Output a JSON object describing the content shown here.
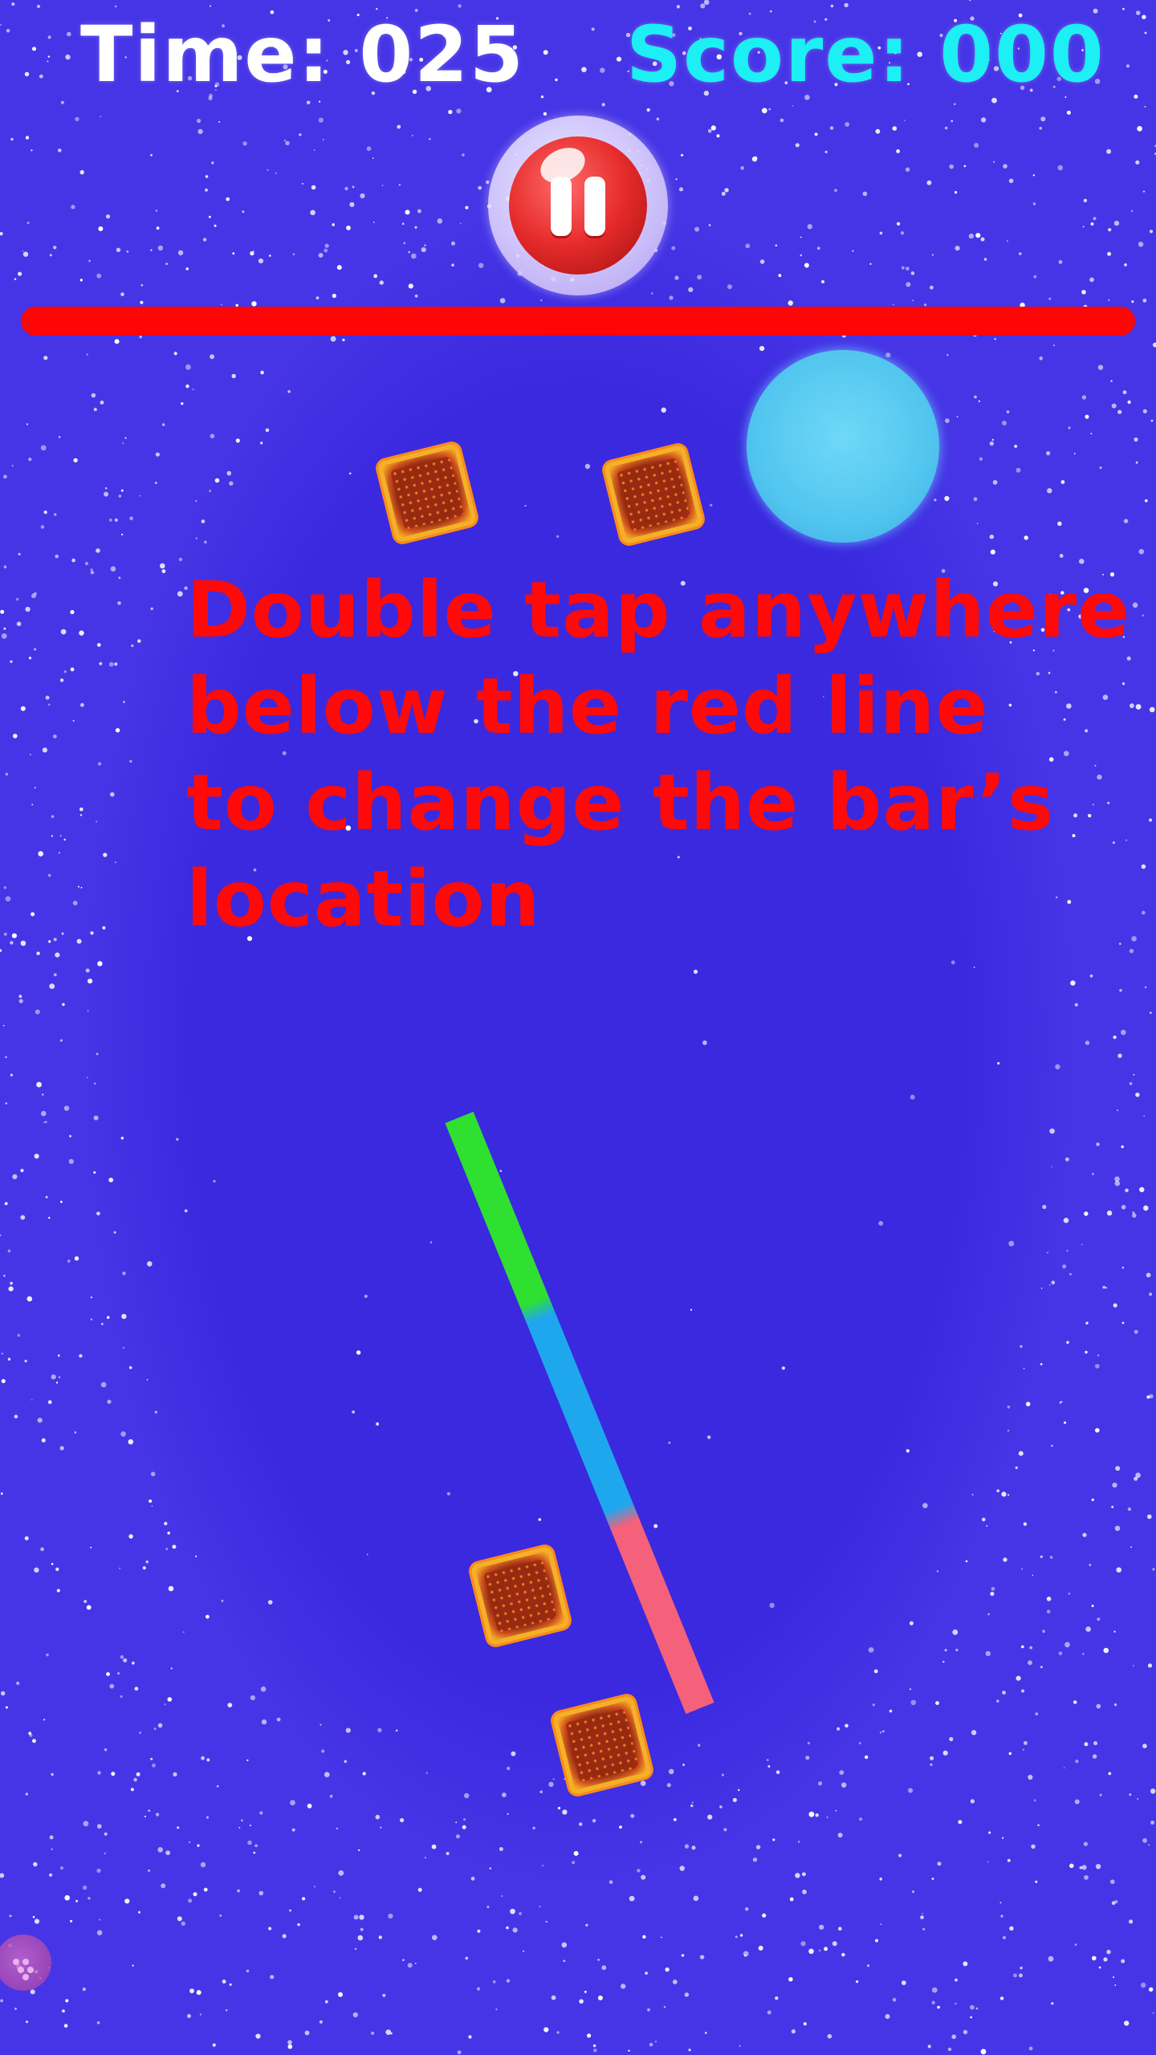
{
  "hud": {
    "time_label": "Time: 025",
    "score_label": "Score: 000"
  },
  "instruction": {
    "lines": [
      "Double tap anywhere",
      "below the red line",
      "to change the bar’s",
      "location"
    ]
  },
  "icons": {
    "pause": "pause-icon",
    "bubble": "bubble-ball",
    "crate": "lava-crate",
    "orb": "purple-orb-icon"
  },
  "colors": {
    "background": "#3b2ae0",
    "time_text": "#ffffff",
    "score_text": "#1cf0f5",
    "instruction_text": "#ff0a0a",
    "red_line": "#ff0505",
    "bar_green": "#2fe030",
    "bar_blue": "#1fa7ee",
    "bar_pink": "#f5607a"
  }
}
